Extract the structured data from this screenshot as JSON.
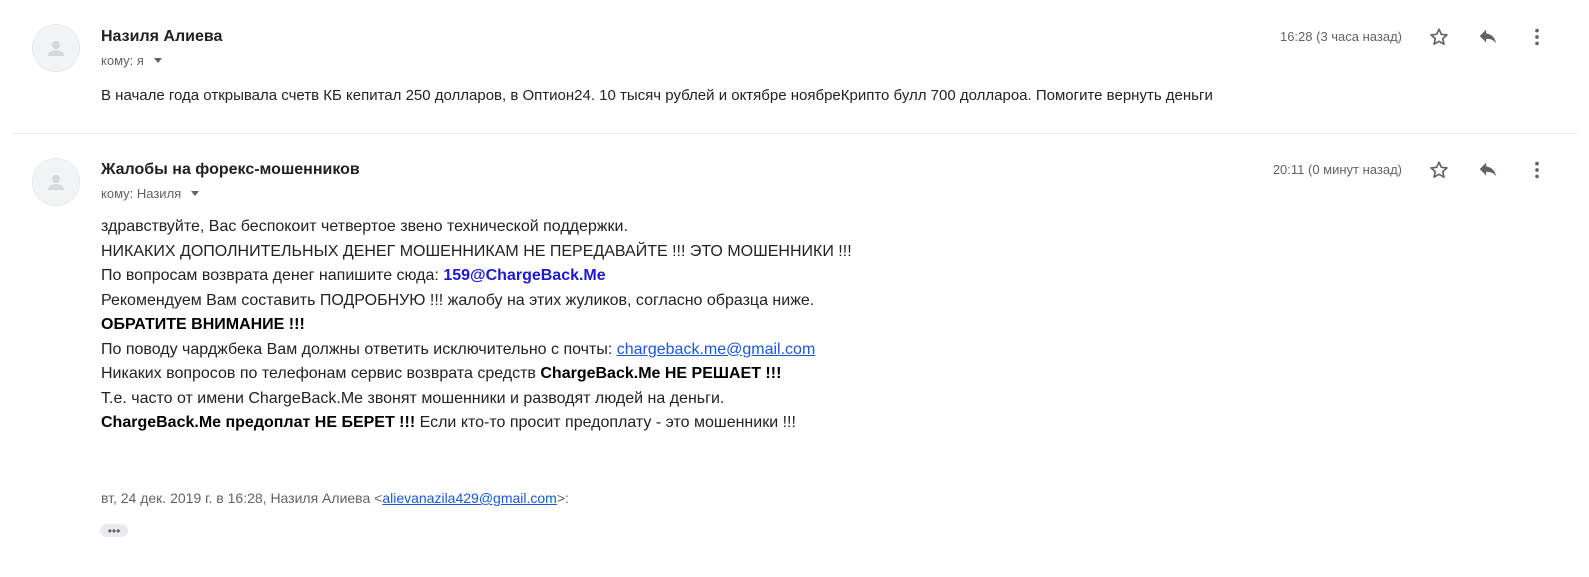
{
  "messages": [
    {
      "sender": "Назиля Алиева",
      "to_label": "кому: я",
      "time": "16:28 (3 часа назад)",
      "body": "В начале года открывала счетв КБ кепитал 250 долларов, в Оптион24. 10 тысяч рублей и октябре ноябреКрипто булл 700 доллароа. Помогите вернуть деньги"
    },
    {
      "sender": "Жалобы на форекс-мошенников",
      "to_label": "кому: Назиля",
      "time": "20:11 (0 минут назад)",
      "lines": {
        "l1": "здравствуйте, Вас беспокоит четвертое звено технической поддержки.",
        "l2": "НИКАКИХ ДОПОЛНИТЕЛЬНЫХ ДЕНЕГ МОШЕННИКАМ НЕ ПЕРЕДАВАЙТЕ !!! ЭТО МОШЕННИКИ !!!",
        "l3_prefix": "По вопросам возврата денег напишите сюда: ",
        "l3_email": "159@ChargeBack.Me",
        "l4": "Рекомендуем Вам составить ПОДРОБНУЮ !!! жалобу на этих жуликов, согласно образца ниже.",
        "l5": "ОБРАТИТЕ ВНИМАНИЕ !!!",
        "l6_prefix": "По поводу чарджбека Вам должны ответить исключительно с почты: ",
        "l6_link": "chargeback.me@gmail.com",
        "l7_prefix": "Никаких вопросов по телефонам сервис возврата средств ",
        "l7_bold": "ChargeBack.Me НЕ РЕШАЕТ !!!",
        "l8": "Т.е. часто от имени ChargeBack.Me звонят мошенники и разводят людей на деньги.",
        "l9_bold": "ChargeBack.Me предоплат НЕ БЕРЕТ !!!",
        "l9_suffix": " Если кто-то просит предоплату - это мошенники !!!"
      },
      "quote": {
        "prefix": "вт, 24 дек. 2019 г. в 16:28, Назиля Алиева <",
        "email": "alievanazila429@gmail.com",
        "suffix": ">:"
      },
      "show_trimmed": "•••"
    }
  ],
  "icons": {
    "avatar": "person-icon",
    "star": "star-icon",
    "reply": "reply-icon",
    "more": "more-vert-icon",
    "caret": "chevron-down-icon"
  },
  "colors": {
    "link": "#1a56db",
    "email_accent": "#1a1ad6",
    "muted": "#5f6368",
    "divider": "#e8eaed"
  }
}
